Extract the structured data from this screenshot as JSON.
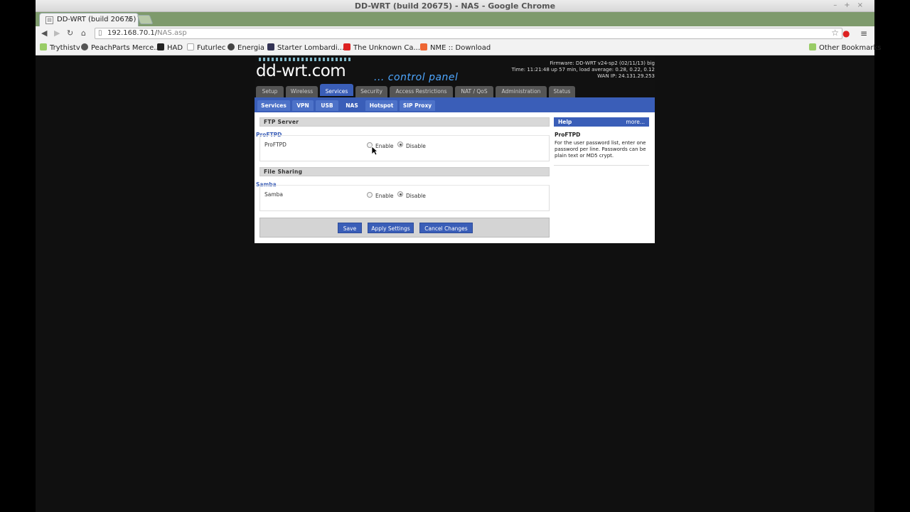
{
  "window": {
    "title": "DD-WRT (build 20675) - NAS - Google Chrome"
  },
  "tab": {
    "label": "DD-WRT (build 20675)"
  },
  "toolbar": {
    "url_host": "192.168.70.1/",
    "url_path": "NAS.asp"
  },
  "bookmarks": {
    "items": [
      "Trythistv",
      "PeachParts Merce...",
      "HAD",
      "Futurlec",
      "Energia",
      "Starter Lombardi...",
      "The Unknown Ca...",
      "NME :: Download"
    ],
    "other": "Other Bookmarks"
  },
  "header": {
    "logo": "dd-wrt.com",
    "subtitle": "... control panel",
    "firmware": "Firmware: DD-WRT v24-sp2 (02/11/13) big",
    "time": "Time: 11:21:48 up 57 min, load average: 0.28, 0.22, 0.12",
    "wan": "WAN IP: 24.131.29.253"
  },
  "main_tabs": [
    "Setup",
    "Wireless",
    "Services",
    "Security",
    "Access Restrictions",
    "NAT / QoS",
    "Administration",
    "Status"
  ],
  "sub_tabs": [
    "Services",
    "VPN",
    "USB",
    "NAS",
    "Hotspot",
    "SIP Proxy"
  ],
  "ftp": {
    "section": "FTP Server",
    "legend": "ProFTPD",
    "label": "ProFTPD",
    "enable": "Enable",
    "disable": "Disable",
    "selected": "Disable"
  },
  "sharing": {
    "section": "File Sharing",
    "legend": "Samba",
    "label": "Samba",
    "enable": "Enable",
    "disable": "Disable",
    "selected": "Disable"
  },
  "buttons": {
    "save": "Save",
    "apply": "Apply Settings",
    "cancel": "Cancel Changes"
  },
  "help": {
    "title": "Help",
    "more": "more...",
    "topic": "ProFTPD",
    "text": "For the user password list, enter one password per line. Passwords can be plain text or MD5 crypt."
  },
  "colors": {
    "accent": "#3a5eb8",
    "tab_inactive": "#555555",
    "browser_tabstrip": "#7e9a6c"
  }
}
